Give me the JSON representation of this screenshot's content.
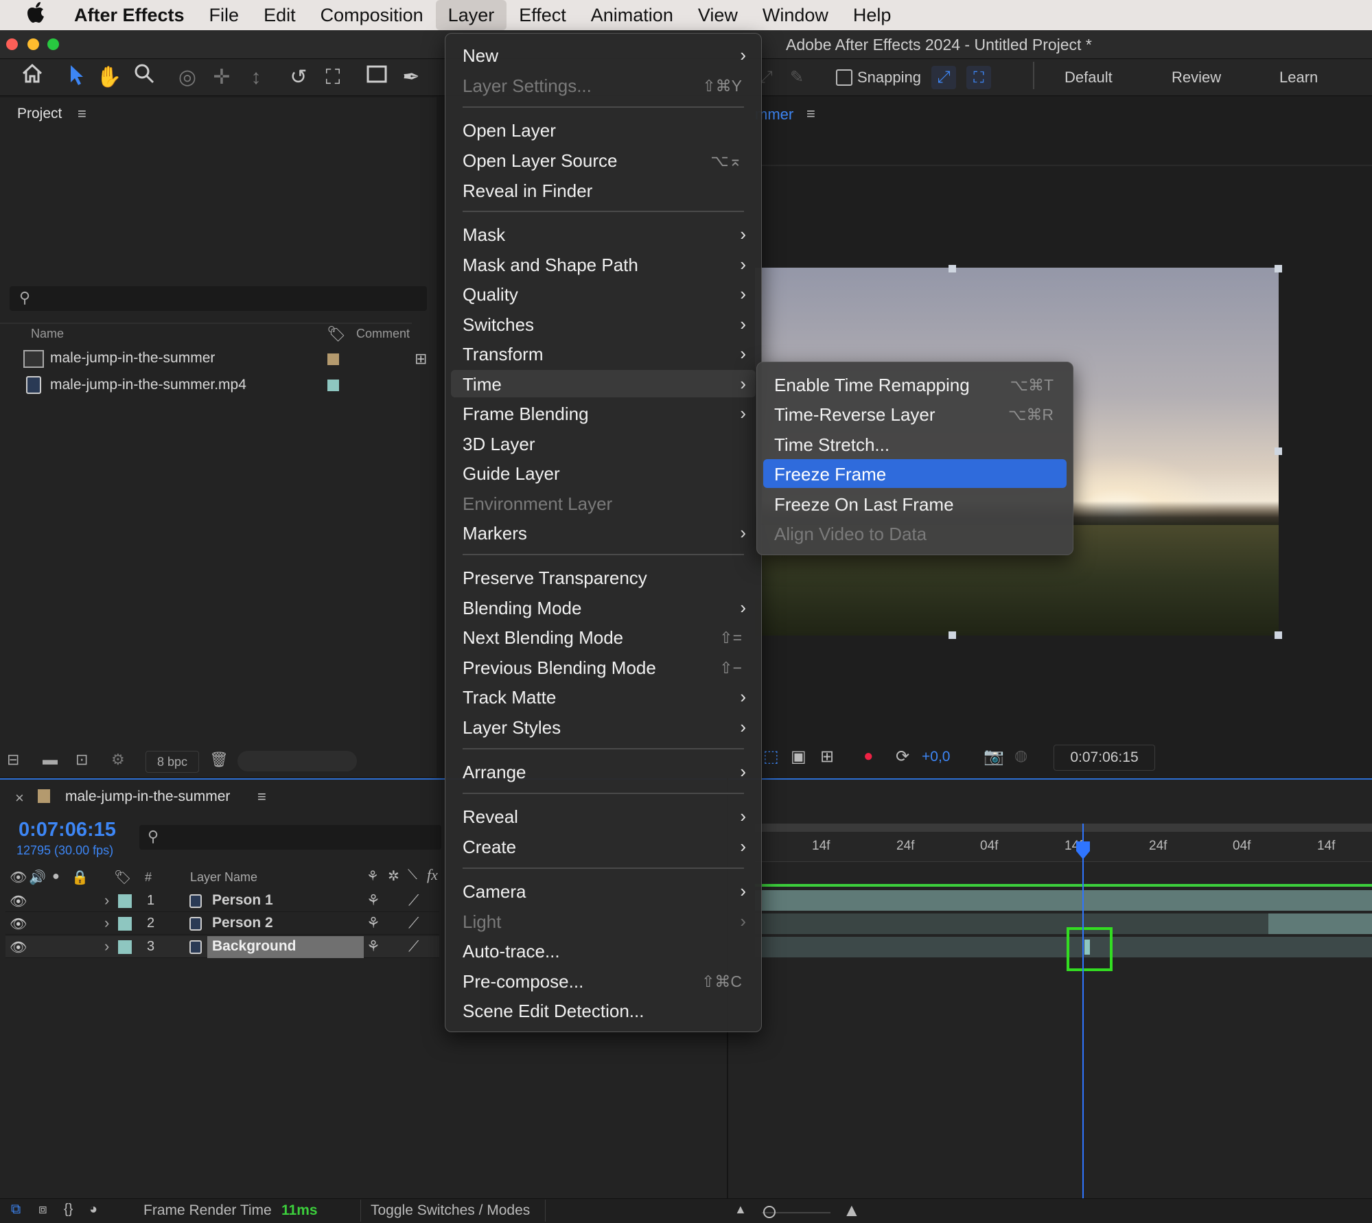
{
  "menubar": {
    "apple": "",
    "app": "After Effects",
    "items": [
      "File",
      "Edit",
      "Composition",
      "Layer",
      "Effect",
      "Animation",
      "View",
      "Window",
      "Help"
    ]
  },
  "window": {
    "title": "Adobe After Effects 2024 - Untitled Project *"
  },
  "toolbar": {
    "snapping": "Snapping",
    "workspaces": [
      "Default",
      "Review",
      "Learn"
    ]
  },
  "project": {
    "title": "Project",
    "columns": {
      "name": "Name",
      "comment": "Comment"
    },
    "items": [
      {
        "name": "male-jump-in-the-summer",
        "label_color": "#b49a6e"
      },
      {
        "name": "male-jump-in-the-summer.mp4",
        "label_color": "#8ec6c0"
      }
    ],
    "bpc": "8 bpc"
  },
  "composition": {
    "tab_partial": "mmer",
    "exposure": "+0,0",
    "timecode": "0:07:06:15"
  },
  "timeline": {
    "comp_name": "male-jump-in-the-summer",
    "timecode": "0:07:06:15",
    "frame_info": "12795 (30.00 fps)",
    "col_num": "#",
    "col_layer": "Layer Name",
    "layers": [
      {
        "num": "1",
        "name": "Person 1"
      },
      {
        "num": "2",
        "name": "Person 2"
      },
      {
        "num": "3",
        "name": "Background"
      }
    ],
    "ruler": [
      "14f",
      "24f",
      "04f",
      "14f",
      "24f",
      "04f",
      "14f"
    ],
    "footer": {
      "render_label": "Frame Render Time",
      "render_value": "11ms",
      "toggle": "Toggle Switches / Modes"
    }
  },
  "layer_menu": {
    "items": [
      {
        "label": "New",
        "submenu": true
      },
      {
        "label": "Layer Settings...",
        "shortcut": "⇧⌘Y",
        "disabled": true
      },
      {
        "label": "Open Layer"
      },
      {
        "label": "Open Layer Source",
        "shortcut": "⌥⌅"
      },
      {
        "label": "Reveal in Finder"
      },
      {
        "label": "Mask",
        "submenu": true
      },
      {
        "label": "Mask and Shape Path",
        "submenu": true
      },
      {
        "label": "Quality",
        "submenu": true
      },
      {
        "label": "Switches",
        "submenu": true
      },
      {
        "label": "Transform",
        "submenu": true
      },
      {
        "label": "Time",
        "submenu": true,
        "highlighted": true
      },
      {
        "label": "Frame Blending",
        "submenu": true
      },
      {
        "label": "3D Layer"
      },
      {
        "label": "Guide Layer"
      },
      {
        "label": "Environment Layer",
        "disabled": true
      },
      {
        "label": "Markers",
        "submenu": true
      },
      {
        "label": "Preserve Transparency"
      },
      {
        "label": "Blending Mode",
        "submenu": true
      },
      {
        "label": "Next Blending Mode",
        "shortcut": "⇧="
      },
      {
        "label": "Previous Blending Mode",
        "shortcut": "⇧−"
      },
      {
        "label": "Track Matte",
        "submenu": true
      },
      {
        "label": "Layer Styles",
        "submenu": true
      },
      {
        "label": "Arrange",
        "submenu": true
      },
      {
        "label": "Reveal",
        "submenu": true
      },
      {
        "label": "Create",
        "submenu": true
      },
      {
        "label": "Camera",
        "submenu": true
      },
      {
        "label": "Light",
        "submenu": true,
        "disabled": true
      },
      {
        "label": "Auto-trace..."
      },
      {
        "label": "Pre-compose...",
        "shortcut": "⇧⌘C"
      },
      {
        "label": "Scene Edit Detection..."
      }
    ]
  },
  "time_submenu": {
    "items": [
      {
        "label": "Enable Time Remapping",
        "shortcut": "⌥⌘T"
      },
      {
        "label": "Time-Reverse Layer",
        "shortcut": "⌥⌘R"
      },
      {
        "label": "Time Stretch..."
      },
      {
        "label": "Freeze Frame",
        "selected": true
      },
      {
        "label": "Freeze On Last Frame"
      },
      {
        "label": "Align Video to Data",
        "disabled": true
      }
    ]
  }
}
